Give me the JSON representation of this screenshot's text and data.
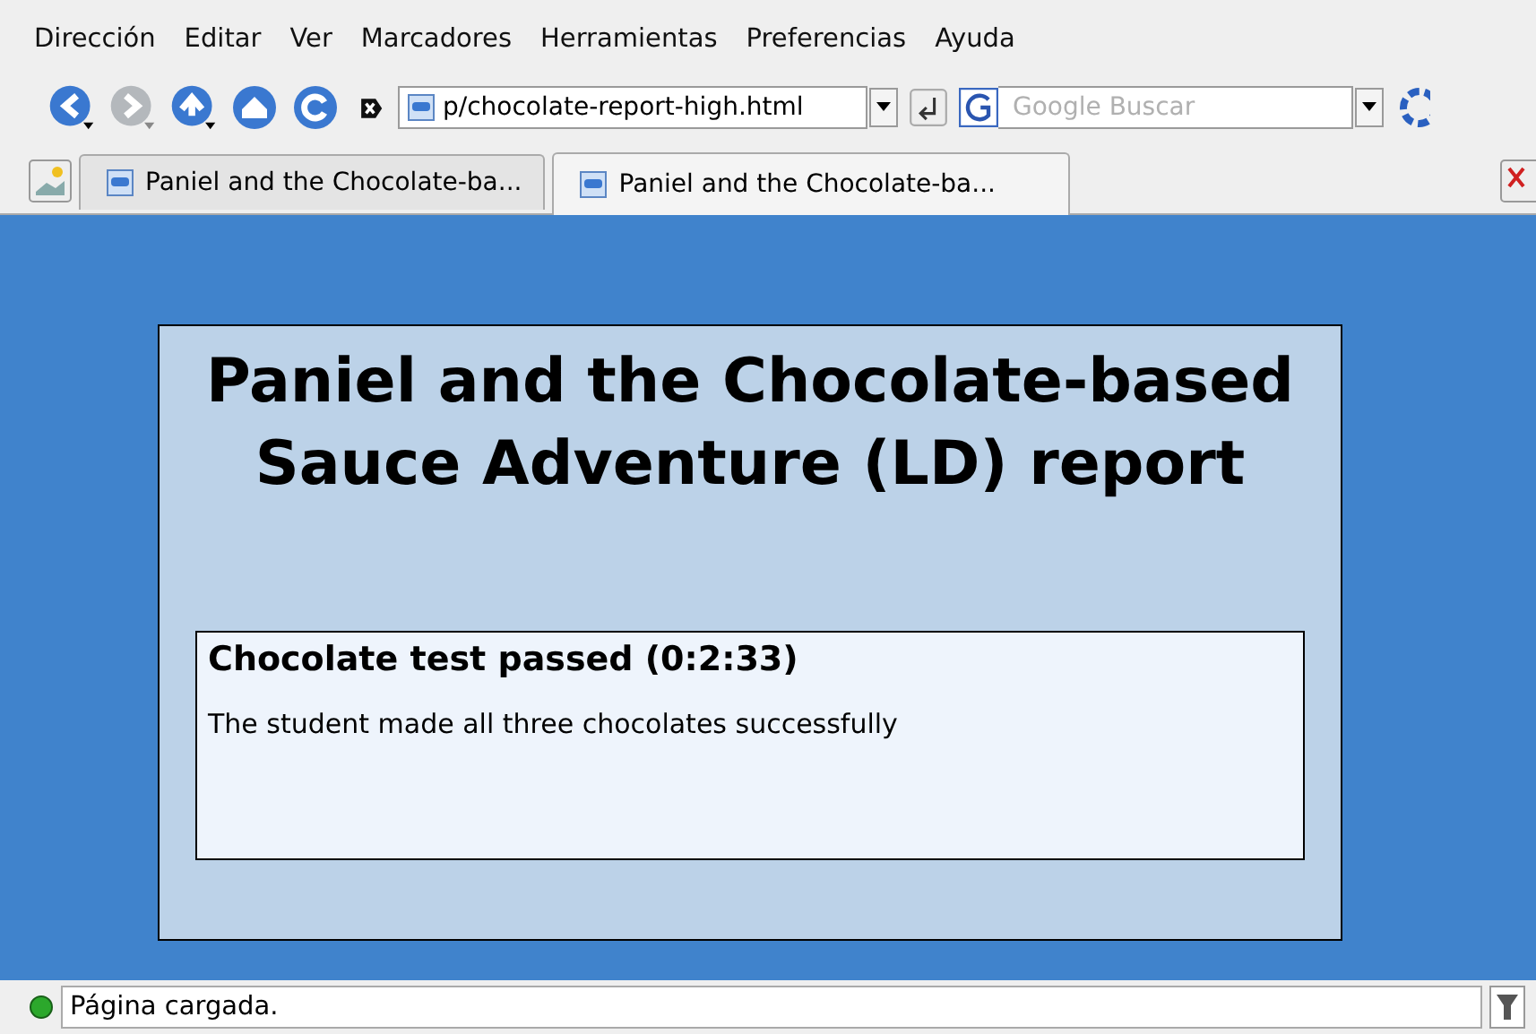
{
  "menu": [
    "Dirección",
    "Editar",
    "Ver",
    "Marcadores",
    "Herramientas",
    "Preferencias",
    "Ayuda"
  ],
  "toolbar": {
    "address": "p/chocolate-report-high.html",
    "search_placeholder": "Google Buscar"
  },
  "tabs": [
    {
      "label": "Paniel and the Chocolate-ba...",
      "selected": false
    },
    {
      "label": "Paniel and the Chocolate-ba...",
      "selected": true
    }
  ],
  "page": {
    "title": "Paniel and the Chocolate-based Sauce Adventure (LD) report",
    "result": {
      "heading": "Chocolate test passed (0:2:33)",
      "text": "The student made all three chocolates successfully"
    }
  },
  "status_bar": {
    "text": "Página cargada."
  }
}
